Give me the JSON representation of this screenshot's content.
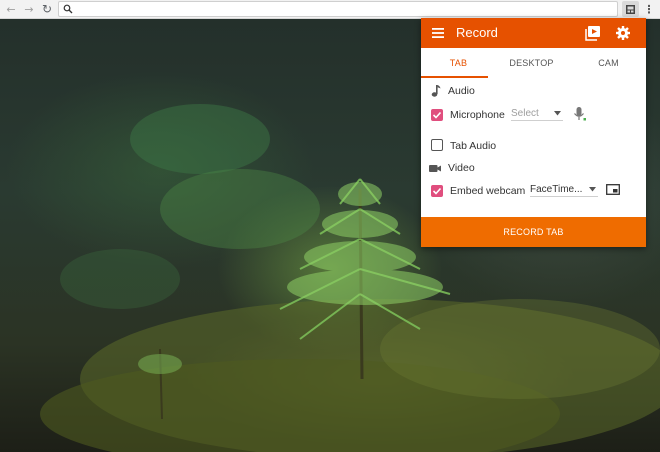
{
  "browser": {
    "back_icon": "arrow-left-icon",
    "forward_icon": "arrow-right-icon",
    "reload_icon": "reload-icon",
    "search_icon": "search-icon",
    "address_value": "",
    "extension_icon": "record-extension-icon",
    "menu_icon": "more-vert-icon",
    "back_glyph": "←",
    "forward_glyph": "→",
    "reload_glyph": "↻",
    "menu_glyph": "⋮"
  },
  "popup": {
    "title": "Record",
    "menu_icon": "hamburger-icon",
    "recordings_icon": "video-library-icon",
    "settings_icon": "gear-icon",
    "accent_color": "#e65100",
    "tabs": [
      {
        "label": "TAB",
        "active": true
      },
      {
        "label": "DESKTOP",
        "active": false
      },
      {
        "label": "CAM",
        "active": false
      }
    ],
    "audio": {
      "heading": "Audio",
      "icon": "music-note-icon",
      "microphone": {
        "label": "Microphone",
        "checked": true,
        "select_value": "Select"
      },
      "tab_audio": {
        "label": "Tab Audio",
        "checked": false
      }
    },
    "video": {
      "heading": "Video",
      "icon": "videocam-icon",
      "webcam": {
        "label": "Embed webcam",
        "checked": true,
        "select_value": "FaceTime..."
      }
    },
    "record_button": "RECORD TAB"
  }
}
